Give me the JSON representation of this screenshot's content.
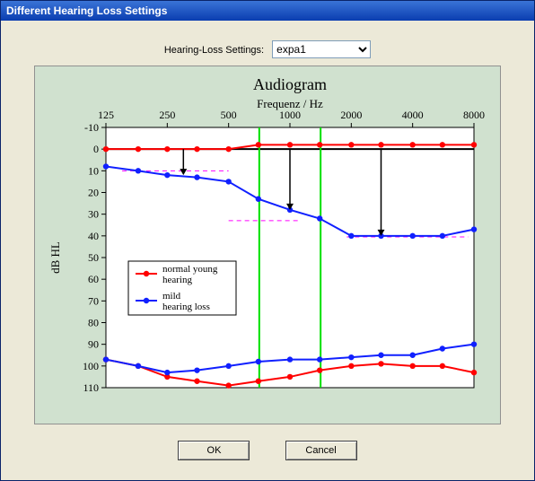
{
  "window": {
    "title": "Different Hearing Loss Settings"
  },
  "controls": {
    "setting_label": "Hearing-Loss Settings:",
    "setting_value": "expa1"
  },
  "buttons": {
    "ok": "OK",
    "cancel": "Cancel"
  },
  "chart_data": {
    "type": "line",
    "title": "Audiogram",
    "xlabel": "Frequenz / Hz",
    "ylabel": "dB HL",
    "x_ticks": [
      125,
      250,
      500,
      1000,
      2000,
      4000,
      8000
    ],
    "y_ticks": [
      -10,
      0,
      10,
      20,
      30,
      40,
      50,
      60,
      70,
      80,
      90,
      100,
      110
    ],
    "ylim": [
      110,
      -10
    ],
    "legend": {
      "position": "inside-lower-left",
      "items": [
        {
          "name": "normal young hearing",
          "color": "#ff0000"
        },
        {
          "name": "mild hearing loss",
          "color": "#1020ff"
        }
      ]
    },
    "vertical_markers_hz": [
      707,
      1414
    ],
    "series": [
      {
        "name": "normal_upper",
        "color": "#ff0000",
        "x": [
          125,
          180,
          250,
          350,
          500,
          700,
          1000,
          1400,
          2000,
          2800,
          4000,
          5600,
          8000
        ],
        "dbhl": [
          0,
          0,
          0,
          0,
          0,
          -2,
          -2,
          -2,
          -2,
          -2,
          -2,
          -2,
          -2
        ]
      },
      {
        "name": "mild_upper",
        "color": "#1020ff",
        "x": [
          125,
          180,
          250,
          350,
          500,
          700,
          1000,
          1400,
          2000,
          2800,
          4000,
          5600,
          8000
        ],
        "dbhl": [
          8,
          10,
          12,
          13,
          15,
          23,
          28,
          32,
          40,
          40,
          40,
          40,
          37
        ]
      },
      {
        "name": "normal_lower",
        "color": "#ff0000",
        "x": [
          125,
          180,
          250,
          350,
          500,
          700,
          1000,
          1400,
          2000,
          2800,
          4000,
          5600,
          8000
        ],
        "dbhl": [
          97,
          100,
          105,
          107,
          109,
          107,
          105,
          102,
          100,
          99,
          100,
          100,
          103
        ]
      },
      {
        "name": "mild_lower",
        "color": "#1020ff",
        "x": [
          125,
          180,
          250,
          350,
          500,
          700,
          1000,
          1400,
          2000,
          2800,
          4000,
          5600,
          8000
        ],
        "dbhl": [
          97,
          100,
          103,
          102,
          100,
          98,
          97,
          97,
          96,
          95,
          95,
          92,
          90
        ]
      }
    ],
    "dashed_lines": [
      {
        "x": [
          150,
          500
        ],
        "dbhl": [
          10,
          10
        ],
        "color": "#ff00ff"
      },
      {
        "x": [
          500,
          1100
        ],
        "dbhl": [
          33,
          33
        ],
        "color": "#ff00ff"
      },
      {
        "x": [
          1900,
          7500
        ],
        "dbhl": [
          40.5,
          40.5
        ],
        "color": "#ff00ff"
      }
    ],
    "arrows": [
      {
        "x_hz": 300,
        "from_db": 0,
        "to_db": 12
      },
      {
        "x_hz": 1000,
        "from_db": 0,
        "to_db": 28
      },
      {
        "x_hz": 2800,
        "from_db": 0,
        "to_db": 40
      }
    ]
  }
}
